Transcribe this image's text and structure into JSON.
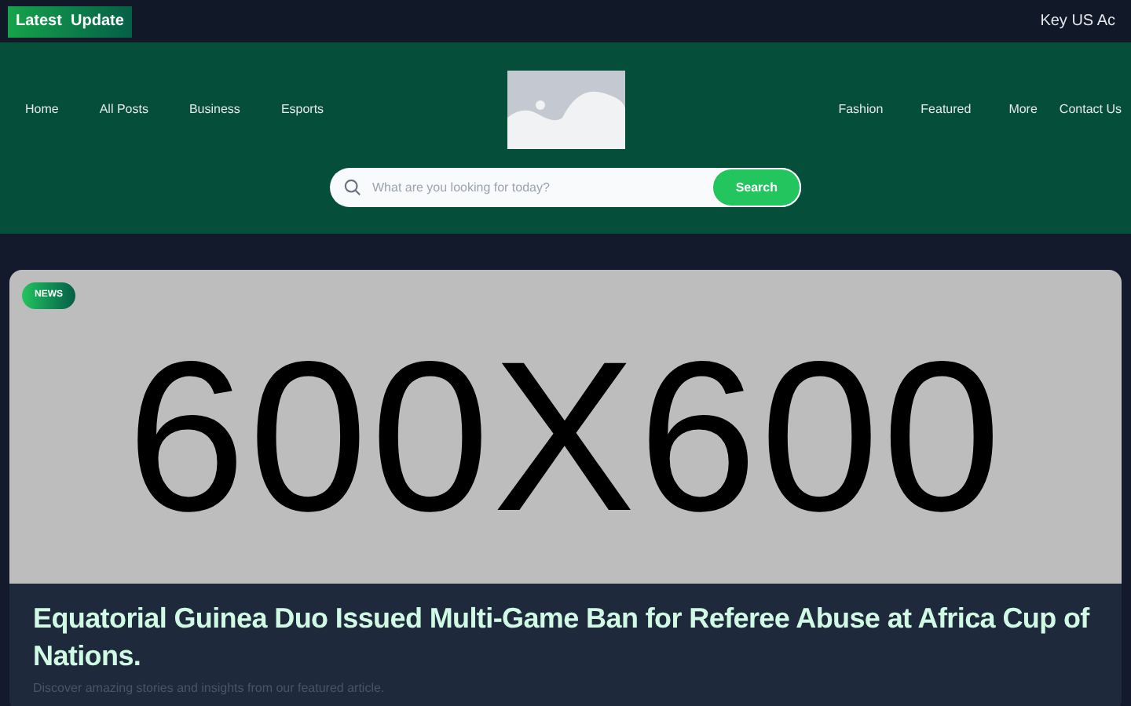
{
  "top_bar": {
    "badge": "Latest  Update",
    "ticker": "Key US Ac"
  },
  "header": {
    "nav_left": [
      "Home",
      "All Posts",
      "Business",
      "Esports"
    ],
    "nav_right": [
      "Fashion",
      "Featured",
      "More",
      "Contact Us"
    ],
    "search": {
      "placeholder": "What are you looking for today?",
      "button": "Search"
    }
  },
  "featured": {
    "tag": "NEWS",
    "image_label": "600X600",
    "title": "Equatorial Guinea Duo Issued Multi-Game Ban for Referee Abuse at Africa Cup of Nations.",
    "subtitle": "Discover amazing stories and insights from our featured article."
  }
}
